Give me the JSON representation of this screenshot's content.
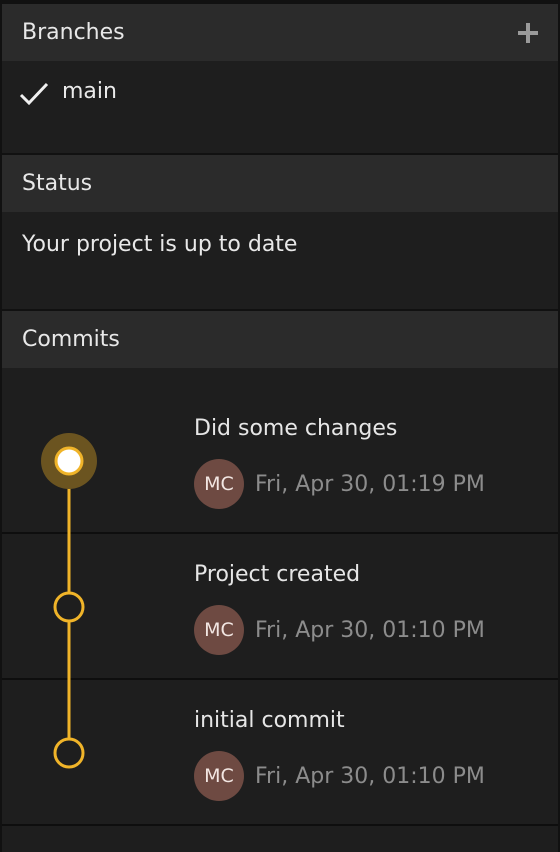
{
  "branches": {
    "title": "Branches",
    "add_icon": "plus-icon",
    "items": [
      {
        "name": "main",
        "active": true,
        "icon": "checkmark-icon"
      }
    ]
  },
  "status": {
    "title": "Status",
    "message": "Your project is up to date"
  },
  "commits": {
    "title": "Commits",
    "accent_color": "#f0b429",
    "items": [
      {
        "message": "Did some changes",
        "author_initials": "MC",
        "date": "Fri, Apr 30, 01:19 PM",
        "current": true
      },
      {
        "message": "Project created",
        "author_initials": "MC",
        "date": "Fri, Apr 30, 01:10 PM",
        "current": false
      },
      {
        "message": "initial commit",
        "author_initials": "MC",
        "date": "Fri, Apr 30, 01:10 PM",
        "current": false
      }
    ]
  }
}
